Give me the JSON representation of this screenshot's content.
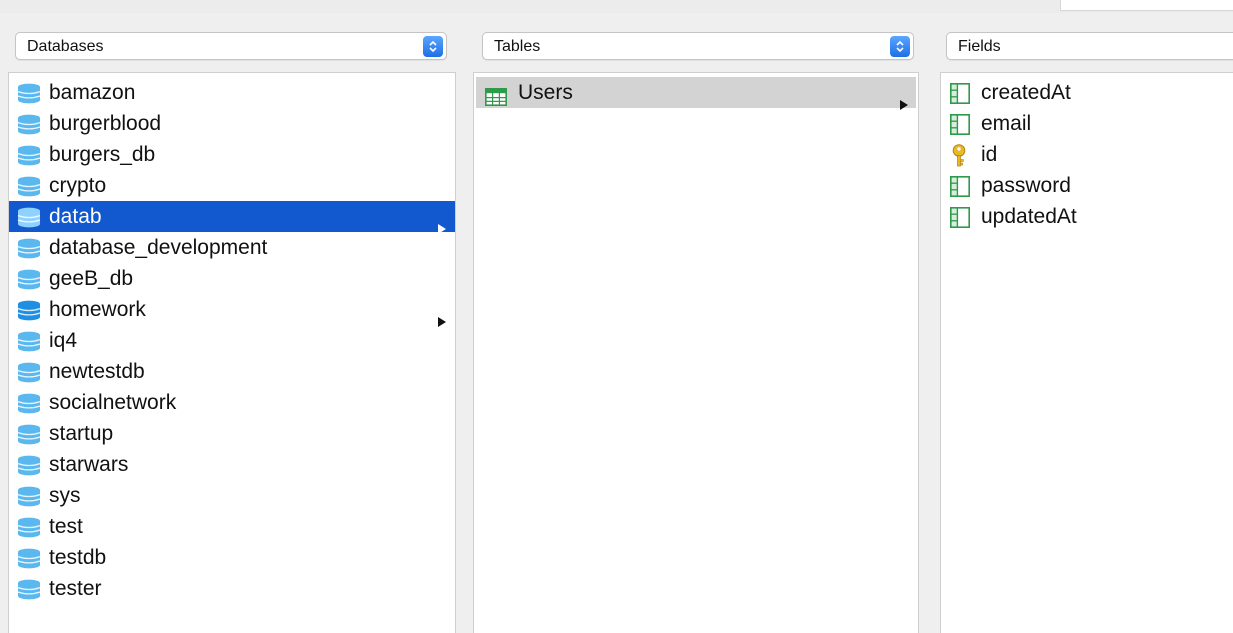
{
  "browser": {
    "databases_popup": {
      "label": "Databases"
    },
    "tables_popup": {
      "label": "Tables"
    },
    "fields_popup": {
      "label": "Fields"
    }
  },
  "databases": {
    "selected": "datab",
    "items": [
      {
        "name": "bamazon"
      },
      {
        "name": "burgerblood"
      },
      {
        "name": "burgers_db"
      },
      {
        "name": "crypto"
      },
      {
        "name": "datab"
      },
      {
        "name": "database_development"
      },
      {
        "name": "geeB_db"
      },
      {
        "name": "homework"
      },
      {
        "name": "iq4"
      },
      {
        "name": "newtestdb"
      },
      {
        "name": "socialnetwork"
      },
      {
        "name": "startup"
      },
      {
        "name": "starwars"
      },
      {
        "name": "sys"
      },
      {
        "name": "test"
      },
      {
        "name": "testdb"
      },
      {
        "name": "tester"
      }
    ]
  },
  "tables": {
    "items": [
      {
        "name": "Users"
      }
    ]
  },
  "fields": {
    "items": [
      {
        "name": "createdAt",
        "icon": "field-icon"
      },
      {
        "name": "email",
        "icon": "field-icon"
      },
      {
        "name": "id",
        "icon": "key-icon"
      },
      {
        "name": "password",
        "icon": "field-icon"
      },
      {
        "name": "updatedAt",
        "icon": "field-icon"
      }
    ]
  },
  "colors": {
    "selection": "#1259cf",
    "table_highlight": "#d3d3d3",
    "db_icon": "#5ab8ef",
    "field_icon": "#2f9a4a",
    "key_icon": "#e9b828"
  }
}
